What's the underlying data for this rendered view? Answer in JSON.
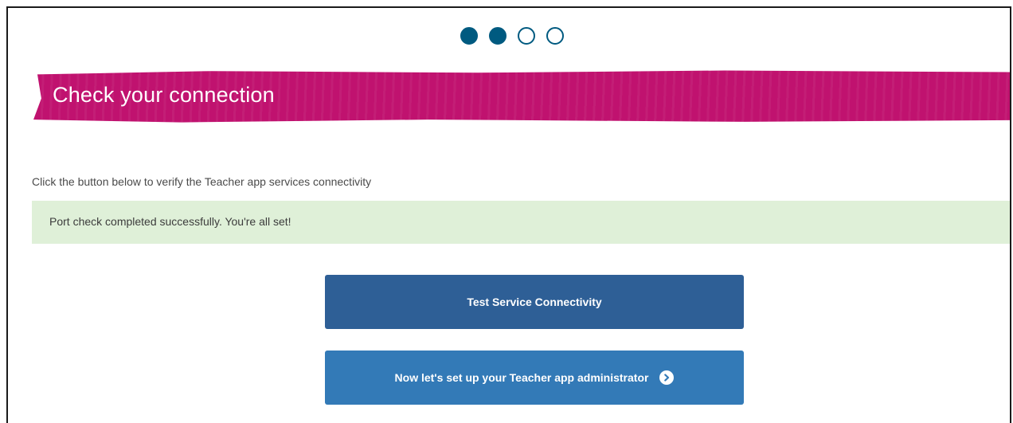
{
  "stepper": {
    "total_steps": 4,
    "current_step": 2,
    "steps": [
      {
        "state": "complete"
      },
      {
        "state": "complete"
      },
      {
        "state": "incomplete"
      },
      {
        "state": "incomplete"
      }
    ],
    "active_color": "#005a80"
  },
  "header": {
    "title": "Check your connection",
    "banner_color": "#c0126f"
  },
  "main": {
    "instruction": "Click the button below to verify the Teacher app services connectivity",
    "status_message": "Port check completed successfully. You're all set!",
    "status_color": "#dff0d8",
    "test_button_label": "Test Service Connectivity",
    "next_button_label": "Now let's set up your Teacher app administrator",
    "next_button_icon": "chevron-right-circle-icon"
  }
}
